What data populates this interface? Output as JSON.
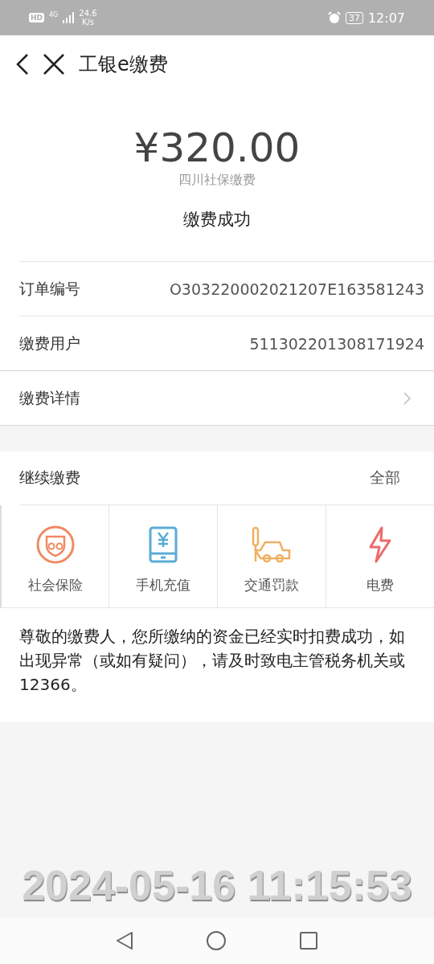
{
  "status_bar": {
    "hd": "HD",
    "network": "4G",
    "speed": "24.6",
    "speed_unit": "K/s",
    "battery": "37",
    "time": "12:07"
  },
  "header": {
    "title": "工银e缴费"
  },
  "summary": {
    "amount": "¥320.00",
    "subtitle": "四川社保缴费",
    "status": "缴费成功"
  },
  "info_rows": [
    {
      "label": "订单编号",
      "value": "O303220002021207E163581243"
    },
    {
      "label": "缴费用户",
      "value": "511302201308171924"
    }
  ],
  "details": {
    "label": "缴费详情"
  },
  "continue": {
    "title": "继续缴费",
    "all": "全部"
  },
  "services": [
    {
      "kind": "insurance",
      "label": "社会保险",
      "color": "#ef8a62"
    },
    {
      "kind": "phone",
      "label": "手机充值",
      "color": "#5aacd6"
    },
    {
      "kind": "traffic",
      "label": "交通罚款",
      "color": "#f0b060"
    },
    {
      "kind": "power",
      "label": "电费",
      "color": "#ec6a6a"
    }
  ],
  "notice": "尊敬的缴费人，您所缴纳的资金已经实时扣费成功，如出现异常（或如有疑问），请及时致电主管税务机关或12366。",
  "timestamp": "2024-05-16 11:15:53"
}
